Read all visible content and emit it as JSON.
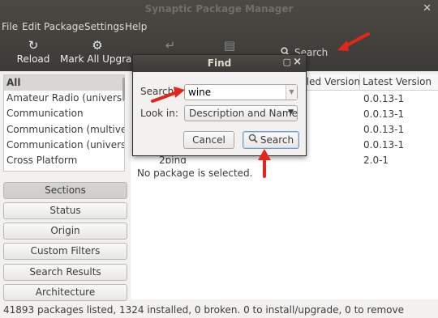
{
  "window": {
    "title": "Synaptic Package Manager",
    "close_glyph": "✕"
  },
  "menu": [
    "File",
    "Edit",
    "Package",
    "Settings",
    "Help"
  ],
  "toolbar": {
    "reload_label": "Reload",
    "mark_all_label": "Mark All Upgrades",
    "search_label": "Search"
  },
  "sections": {
    "items": [
      "All",
      "Amateur Radio (universe)",
      "Communication",
      "Communication (multiverse)",
      "Communication (universe)",
      "Cross Platform"
    ],
    "selected": "All"
  },
  "filter_buttons": [
    "Sections",
    "Status",
    "Origin",
    "Custom Filters",
    "Search Results",
    "Architecture"
  ],
  "package_table": {
    "columns": [
      "Installed Version",
      "Latest Version"
    ],
    "latest_versions": [
      "0.0.13-1",
      "0.0.13-1",
      "0.0.13-1",
      "0.0.13-1",
      "2.0-1"
    ],
    "partial_package_name": "2ping"
  },
  "details": {
    "empty_text": "No package is selected."
  },
  "status_bar": "41893 packages listed, 1324 installed, 0 broken. 0 to install/upgrade, 0 to remove",
  "find_dialog": {
    "title": "Find",
    "search_label": "Search:",
    "search_value": "wine",
    "look_in_label": "Look in:",
    "look_in_value": "Description and Name",
    "cancel_label": "Cancel",
    "search_button_label": "Search"
  },
  "colors": {
    "titlebar": "#3c3b37",
    "arrow": "#e3261c",
    "selected_row": "#d8d7d4"
  }
}
